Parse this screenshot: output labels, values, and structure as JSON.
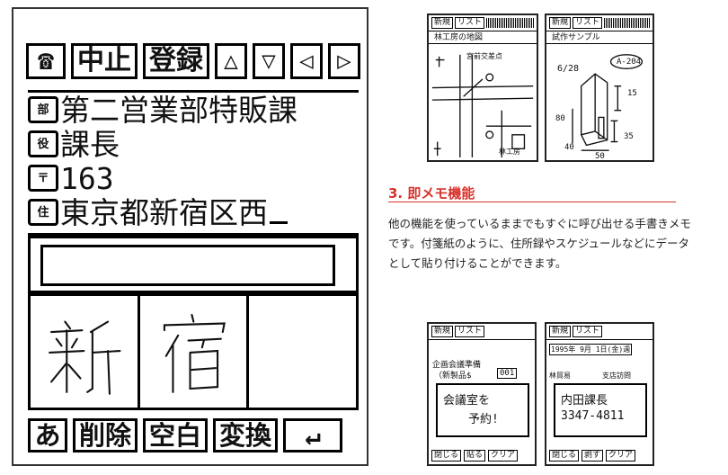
{
  "big_device": {
    "toolbar": {
      "phone_icon_label": "☎",
      "cancel_label": "中止",
      "register_label": "登録",
      "up_label": "△",
      "down_label": "▽",
      "left_label": "◁",
      "right_label": "▷"
    },
    "info": {
      "department_prefix": "部",
      "department": "第二営業部特販課",
      "title_prefix": "役",
      "title": "課長",
      "zip_prefix": "〒",
      "zip": "163",
      "address_prefix": "住",
      "address": "東京都新宿区西"
    },
    "handwriting": [
      "新",
      "宿",
      ""
    ],
    "bottom": {
      "mode_icon_label": "あ",
      "delete_label": "削除",
      "space_label": "空白",
      "convert_label": "変換",
      "enter_label": "↵"
    }
  },
  "screen_map": {
    "new_label": "新規",
    "list_label": "リスト",
    "title": "林工房の地図",
    "landmark": "宮前交差点",
    "place_label": "林工房"
  },
  "screen_sketch": {
    "new_label": "新規",
    "list_label": "リスト",
    "title": "試作サンプル",
    "date": "6/28",
    "code": "A-204",
    "dim_15": "15",
    "dim_80": "80",
    "dim_35": "35",
    "dim_40": "40",
    "dim_50": "50"
  },
  "section": {
    "title": "3. 即メモ機能",
    "body": "他の機能を使っているままでもすぐに呼び出せる手書きメモです。付箋紙のように、住所録やスケジュールなどにデータとして貼り付けることができます。"
  },
  "screen_memo1": {
    "new_label": "新規",
    "list_label": "リスト",
    "line1": "企画会議準備",
    "line2": "（新製品$",
    "num": "001",
    "note1": "会議室を",
    "note2": "予約!",
    "close_label": "閉じる",
    "paste_label": "貼る",
    "clear_label": "クリア"
  },
  "screen_memo2": {
    "new_label": "新規",
    "list_label": "リスト",
    "date": "1995年 9月 1日(金)週",
    "event1": "林貿易",
    "event2": "支店訪問",
    "note1": "内田課長",
    "note2": "3347-4811",
    "close_label": "閉じる",
    "remove_label": "剥す",
    "clear_label": "クリア"
  }
}
